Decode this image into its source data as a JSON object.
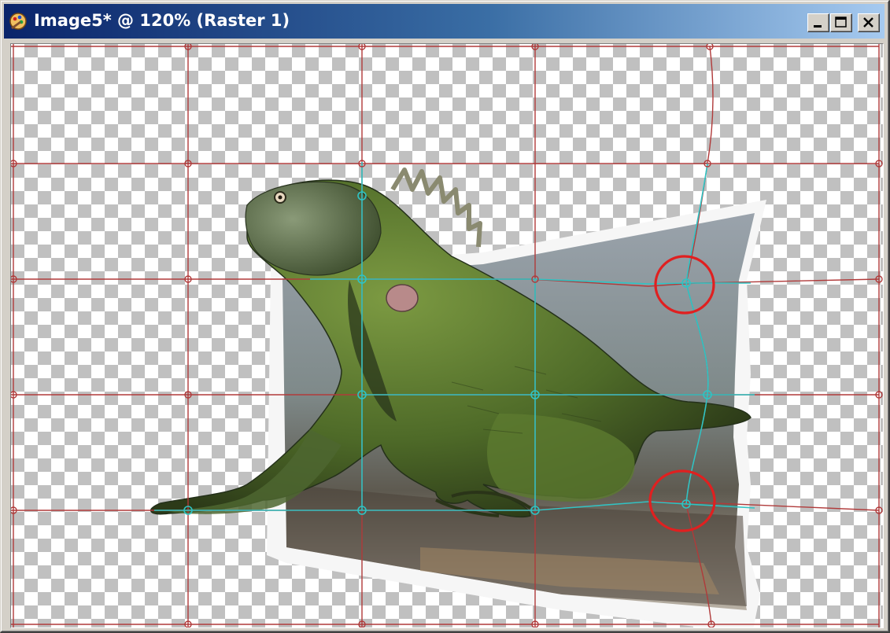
{
  "window": {
    "title": "Image5* @ 120% (Raster 1)",
    "title_bar_colors": [
      "#0a246a",
      "#a6caf0"
    ]
  },
  "title_buttons": {
    "minimize": "minimize-icon",
    "maximize": "maximize-icon",
    "close": "close-icon"
  },
  "canvas": {
    "layer": "Raster 1",
    "zoom": "120%",
    "image_subject": "green iguana photo on a warped white-bordered frame",
    "grid_color": "#b04040",
    "mesh_color": "#2ec4c4",
    "highlight_color": "#e02020",
    "highlight_count": 2
  }
}
